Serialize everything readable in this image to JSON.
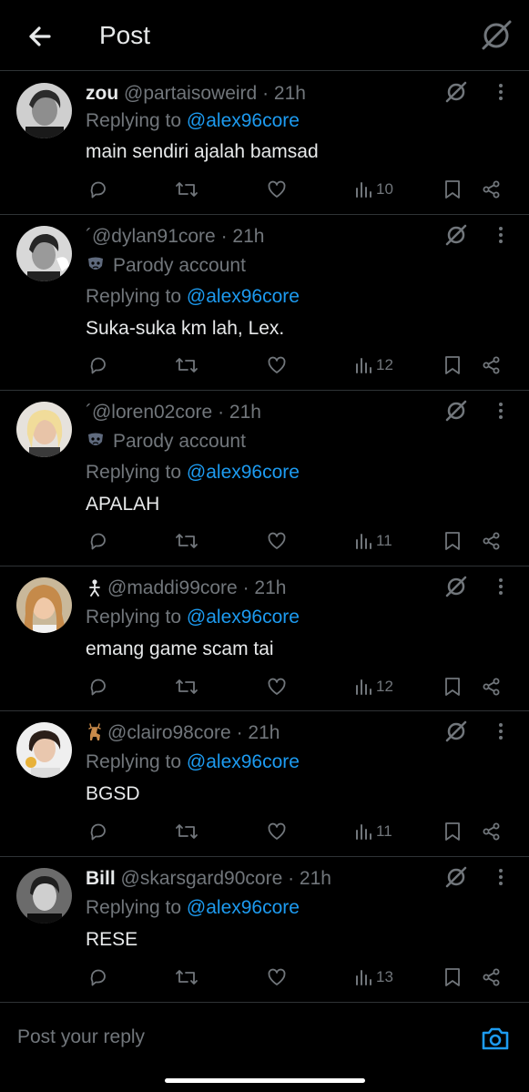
{
  "header": {
    "title": "Post"
  },
  "colors": {
    "accent": "#1d9bf0",
    "muted": "#71767b",
    "text": "#e7e9ea",
    "divider": "#2f3336"
  },
  "replies": [
    {
      "name": "zou",
      "handle": "@partaisoweird",
      "time": "· 21h",
      "replying_prefix": "Replying to ",
      "replying_to": "@alex96core",
      "text": "main sendiri ajalah bamsad",
      "views": "10"
    },
    {
      "name": "",
      "handle": "´@dylan91core",
      "time": "· 21h",
      "parody": "Parody account",
      "replying_prefix": "Replying to ",
      "replying_to": "@alex96core",
      "text": "Suka-suka km lah, Lex.",
      "views": "12"
    },
    {
      "name": "",
      "handle": "´@loren02core",
      "time": "· 21h",
      "parody": "Parody account",
      "replying_prefix": "Replying to ",
      "replying_to": "@alex96core",
      "text": "APALAH",
      "views": "11"
    },
    {
      "name": "",
      "handle": "@maddi99core",
      "time": "· 21h",
      "name_icon": "person-emoji-icon",
      "replying_prefix": "Replying to ",
      "replying_to": "@alex96core",
      "text": "emang game scam tai",
      "views": "12"
    },
    {
      "name": "",
      "handle": "@clairo98core",
      "time": "· 21h",
      "name_icon": "deer-emoji-icon",
      "replying_prefix": "Replying to ",
      "replying_to": "@alex96core",
      "text": "BGSD",
      "views": "11"
    },
    {
      "name": "Bill",
      "handle": "@skarsgard90core",
      "time": "· 21h",
      "replying_prefix": "Replying to ",
      "replying_to": "@alex96core",
      "text": "RESE",
      "views": "13"
    }
  ],
  "compose": {
    "placeholder": "Post your reply"
  },
  "icons": {
    "back": "arrow-left-icon",
    "grok": "grok-icon",
    "more": "more-vertical-icon",
    "reply": "reply-icon",
    "repost": "repost-icon",
    "like": "heart-icon",
    "views": "views-icon",
    "bookmark": "bookmark-icon",
    "share": "share-icon",
    "camera": "camera-icon"
  }
}
